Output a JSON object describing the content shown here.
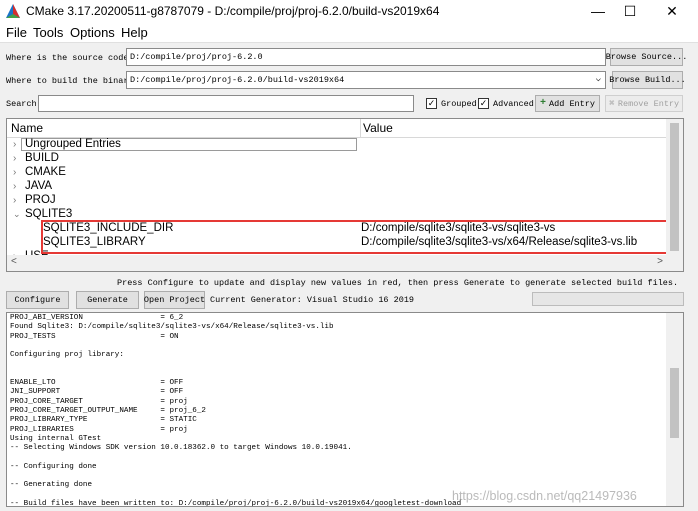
{
  "window": {
    "title": "CMake 3.17.20200511-g8787079 - D:/compile/proj/proj-6.2.0/build-vs2019x64",
    "minimize": "—",
    "maximize": "☐",
    "close": "✕"
  },
  "menu": [
    "File",
    "Tools",
    "Options",
    "Help"
  ],
  "source": {
    "label": "Where is the source code:",
    "value": "D:/compile/proj/proj-6.2.0",
    "browse": "Browse Source..."
  },
  "build": {
    "label": "Where to build the binaries:",
    "value": "D:/compile/proj/proj-6.2.0/build-vs2019x64",
    "browse": "Browse Build..."
  },
  "search": {
    "label": "Search:",
    "value": "",
    "grouped_label": "Grouped",
    "grouped_checked": "✓",
    "advanced_label": "Advanced",
    "advanced_checked": "✓",
    "add_entry": "Add Entry",
    "remove_entry": "Remove Entry"
  },
  "tree": {
    "col_name": "Name",
    "col_value": "Value",
    "groups": [
      "Ungrouped Entries",
      "BUILD",
      "CMAKE",
      "JAVA",
      "PROJ",
      "SQLITE3"
    ],
    "entries": [
      {
        "name": "SQLITE3_INCLUDE_DIR",
        "value": "D:/compile/sqlite3/sqlite3-vs/sqlite3-vs"
      },
      {
        "name": "SQLITE3_LIBRARY",
        "value": "D:/compile/sqlite3/sqlite3-vs/x64/Release/sqlite3-vs.lib"
      }
    ],
    "last_group": "USE",
    "hscroll_left": "<",
    "hscroll_right": ">"
  },
  "hint": "Press Configure to update and display new values in red, then press Generate to generate selected build files.",
  "actions": {
    "configure": "Configure",
    "generate": "Generate",
    "open_project": "Open Project",
    "generator": "Current Generator: Visual Studio 16 2019"
  },
  "log": [
    "PROJ_ABI_VERSION                 = 6_2",
    "Found Sqlite3: D:/compile/sqlite3/sqlite3-vs/x64/Release/sqlite3-vs.lib",
    "PROJ_TESTS                       = ON",
    "",
    "Configuring proj library:",
    "",
    "",
    "ENABLE_LTO                       = OFF",
    "JNI_SUPPORT                      = OFF",
    "PROJ_CORE_TARGET                 = proj",
    "PROJ_CORE_TARGET_OUTPUT_NAME     = proj_6_2",
    "PROJ_LIBRARY_TYPE                = STATIC",
    "PROJ_LIBRARIES                   = proj",
    "Using internal GTest",
    "-- Selecting Windows SDK version 10.0.18362.0 to target Windows 10.0.19041.",
    "",
    "-- Configuring done",
    "",
    "-- Generating done",
    "",
    "-- Build files have been written to: D:/compile/proj/proj-6.2.0/build-vs2019x64/googletest-download"
  ],
  "watermark": "https://blog.csdn.net/qq21497936"
}
